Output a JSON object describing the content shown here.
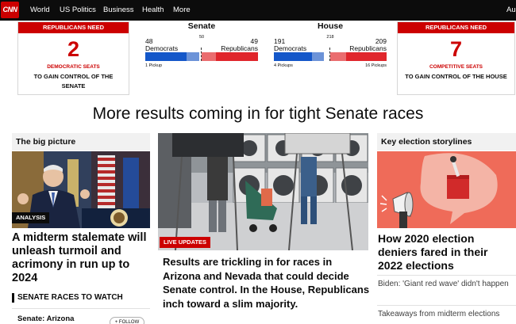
{
  "nav": {
    "logo": "CNN",
    "items": [
      "World",
      "US Politics",
      "Business",
      "Health",
      "More"
    ],
    "right_clip": "Au"
  },
  "senate_need": {
    "head": "REPUBLICANS NEED",
    "number": "2",
    "sub": "DEMOCRATIC SEATS",
    "desc": "TO GAIN CONTROL OF THE SENATE"
  },
  "house_need": {
    "head": "REPUBLICANS NEED",
    "number": "7",
    "sub": "COMPETITIVE SEATS",
    "desc": "TO GAIN CONTROL OF THE HOUSE"
  },
  "senate": {
    "title": "Senate",
    "dem_count": "48",
    "dem_label": "Democrats",
    "majority": "50",
    "rep_count": "49",
    "rep_label": "Republicans",
    "pickups": "1 Pickup",
    "dem_fraction": 0.48,
    "rep_fraction": 0.49
  },
  "house": {
    "title": "House",
    "dem_count": "191",
    "dem_label": "Democrats",
    "majority": "218",
    "rep_count": "209",
    "rep_label": "Republicans",
    "dem_pickups": "4 Pickups",
    "rep_pickups": "16 Pickups",
    "dem_fraction": 0.44,
    "rep_fraction": 0.48
  },
  "headline": "More results coming in for tight Senate races",
  "left_column": {
    "header": "The big picture",
    "badge": "ANALYSIS",
    "story": "A midterm stalemate will unleash turmoil and acrimony in run up to 2024",
    "section": "SENATE RACES TO WATCH",
    "race_name": "Senate: Arizona",
    "follow": "+ FOLLOW"
  },
  "center_column": {
    "badge": "LIVE UPDATES",
    "story": "Results are trickling in for races in Arizona and Nevada that could decide Senate control. In the House, Republicans inch toward a slim majority."
  },
  "right_column": {
    "header": "Key election storylines",
    "story": "How 2020 election deniers fared in their 2022 elections",
    "link1": "Biden: 'Giant red wave' didn't happen",
    "link2": "Takeaways from midterm elections"
  },
  "colors": {
    "cnn_red": "#cc0000",
    "dem_blue": "#1457c9",
    "rep_red": "#e0262c",
    "nav_black": "#0c0c0c"
  }
}
